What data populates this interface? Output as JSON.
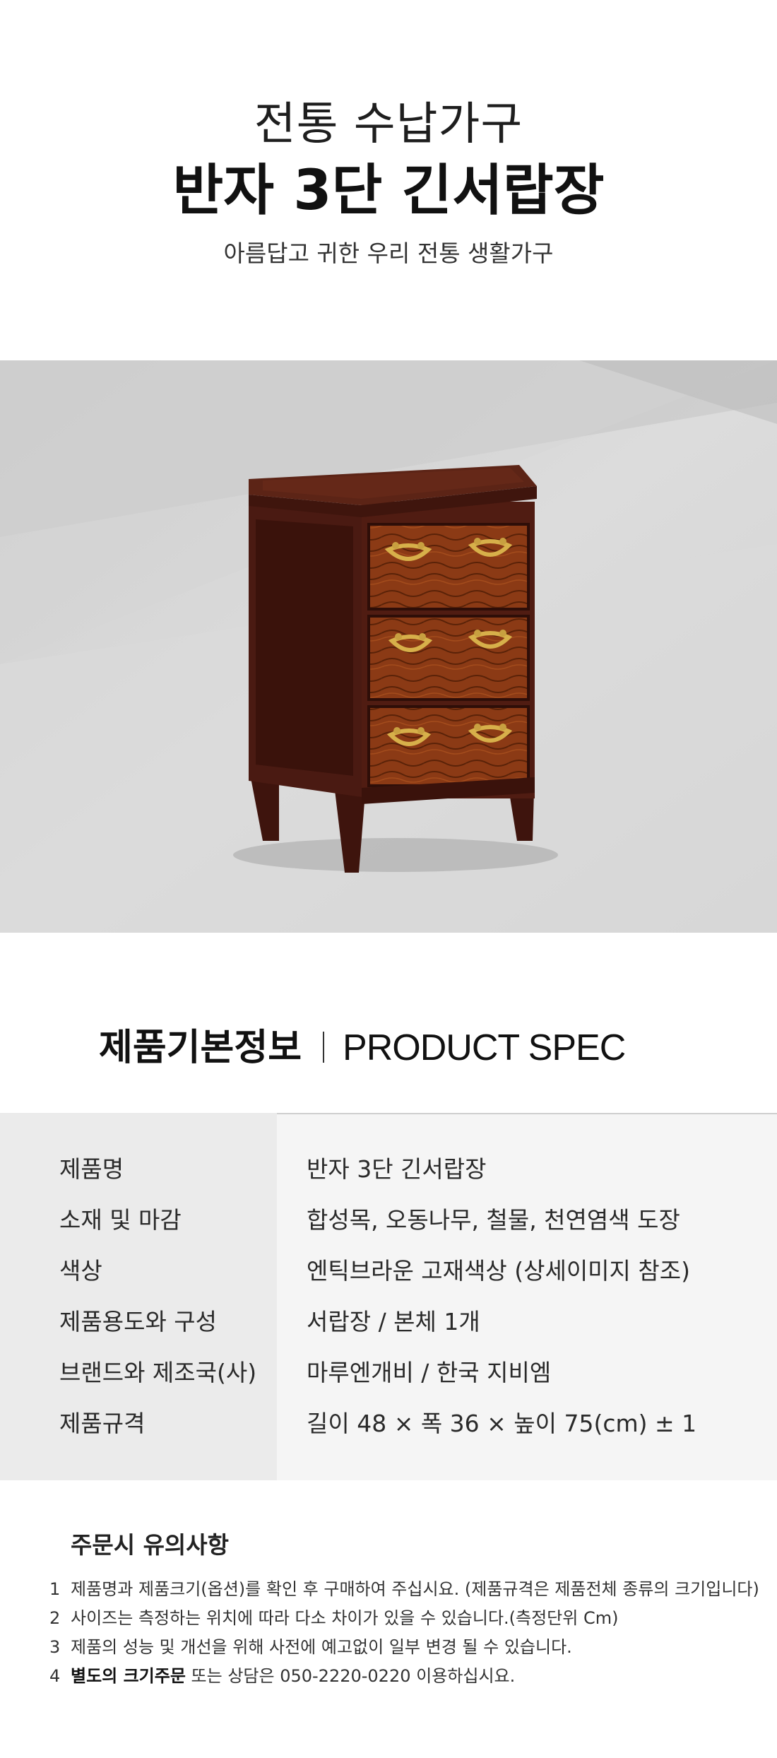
{
  "header": {
    "title_line1": "전통 수납가구",
    "title_line2": "반자 3단 긴서랍장",
    "subtitle": "아름답고 귀한 우리 전통 생활가구"
  },
  "spec": {
    "heading_ko": "제품기본정보",
    "heading_en": "PRODUCT SPEC",
    "rows": [
      {
        "label": "제품명",
        "value": "반자 3단 긴서랍장"
      },
      {
        "label": "소재 및 마감",
        "value": "합성목, 오동나무, 철물, 천연염색 도장"
      },
      {
        "label": "색상",
        "value": "엔틱브라운 고재색상 (상세이미지 참조)"
      },
      {
        "label": "제품용도와 구성",
        "value": "서랍장 / 본체 1개"
      },
      {
        "label": "브랜드와 제조국(사)",
        "value": "마루엔개비 / 한국 지비엠"
      },
      {
        "label": "제품규격",
        "value": "길이 48 × 폭 36 × 높이 75(cm) ± 1"
      }
    ]
  },
  "notes": {
    "title": "주문시 유의사항",
    "items": [
      {
        "num": "1",
        "text": "제품명과 제품크기(옵션)를 확인 후 구매하여 주십시요. (제품규격은 제품전체 종류의 크기입니다)"
      },
      {
        "num": "2",
        "text": "사이즈는 측정하는 위치에 따라 다소 차이가 있을 수 있습니다.(측정단위 Cm)"
      },
      {
        "num": "3",
        "text": "제품의 성능 및 개선을 위해 사전에 예고없이 일부 변경 될 수 있습니다."
      },
      {
        "num": "4",
        "bold": "별도의 크기주문",
        "text": " 또는 상담은 050-2220-0220 이용하십시요."
      }
    ]
  },
  "colors": {
    "wood_dark": "#4a1a12",
    "wood_drawer": "#8a3a16",
    "brass": "#c8a040",
    "photo_bg": "#d6d6d6"
  }
}
